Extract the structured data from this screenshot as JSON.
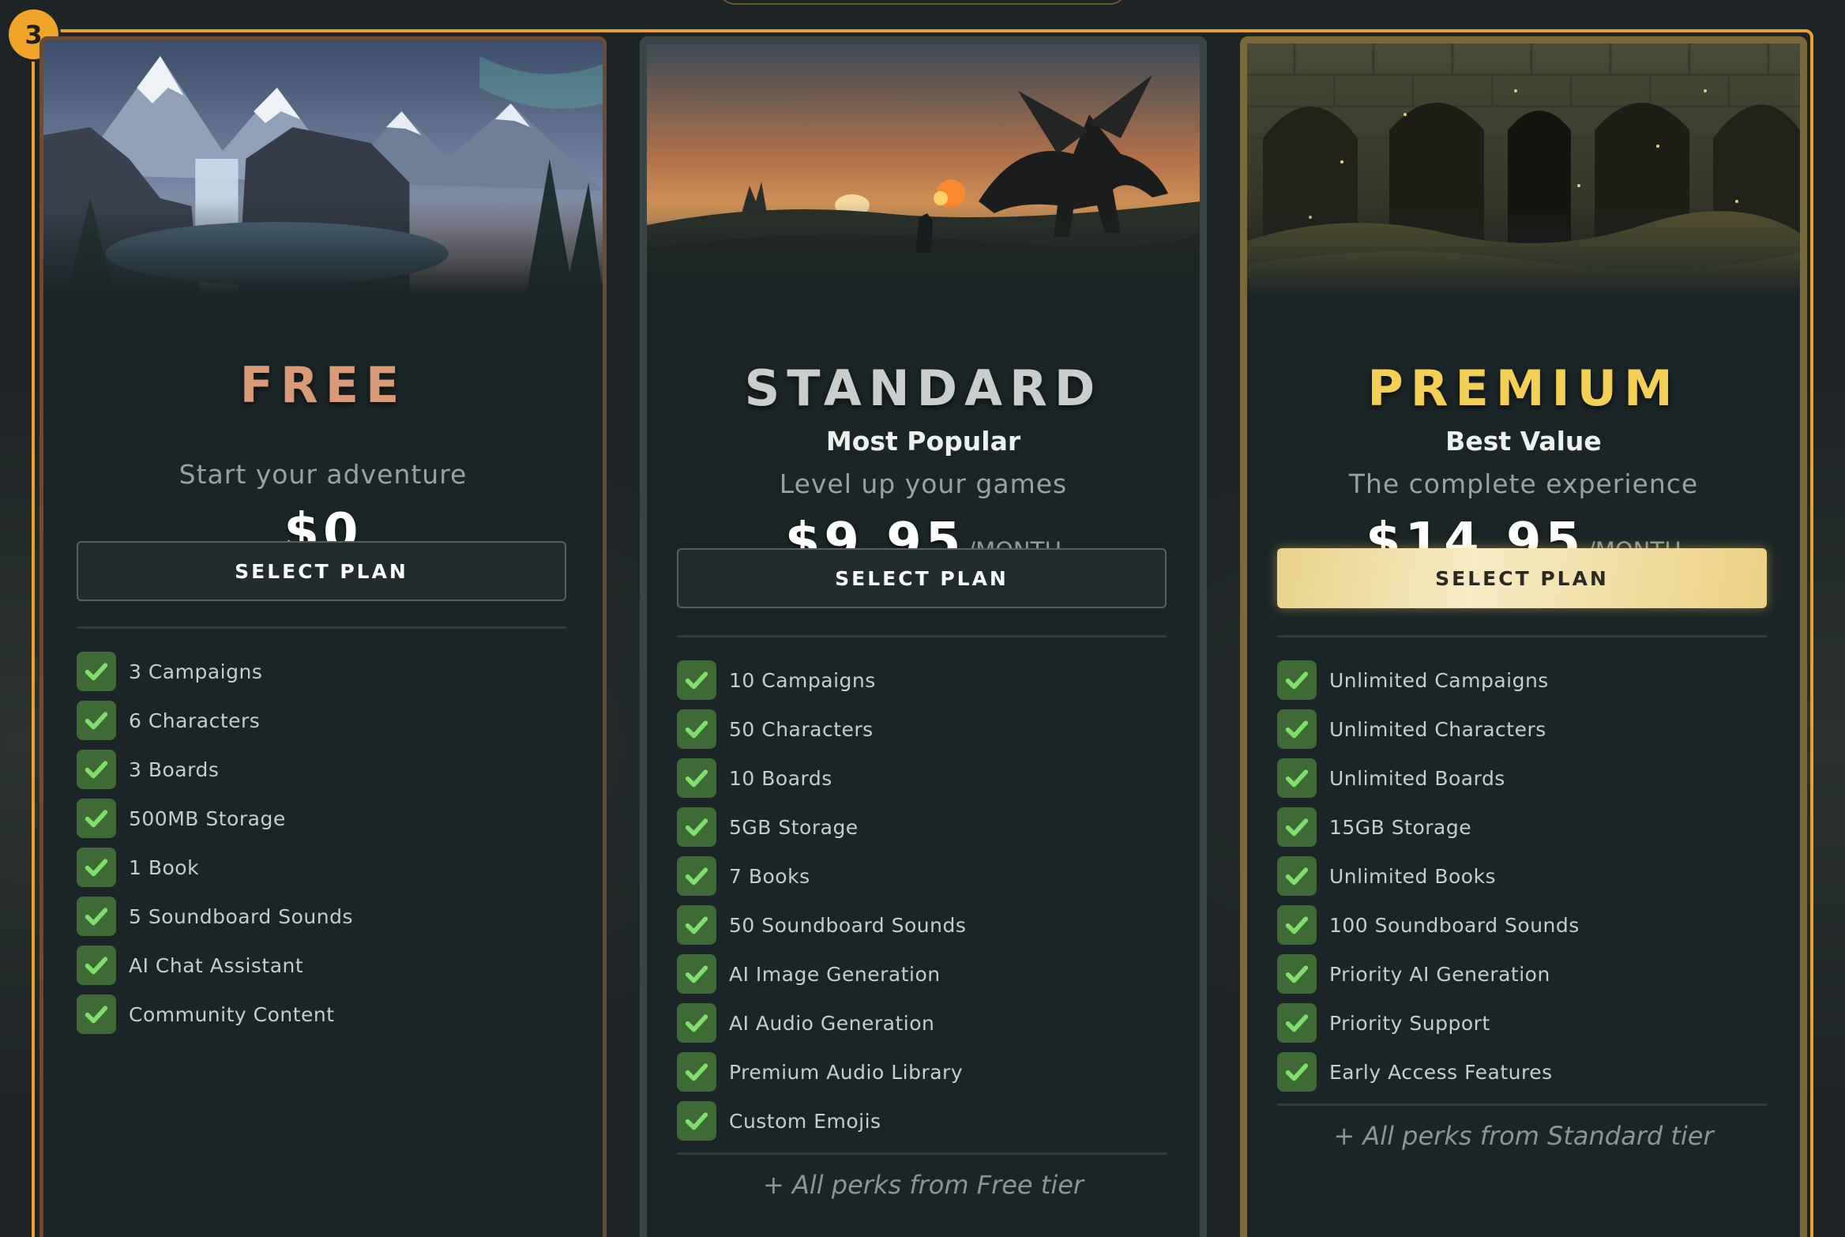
{
  "step_badge": "3",
  "plans": [
    {
      "id": "free",
      "name": "FREE",
      "badge": "",
      "tagline": "Start your adventure",
      "price": "$0",
      "period": "",
      "button_label": "SELECT PLAN",
      "features": [
        "3 Campaigns",
        "6 Characters",
        "3 Boards",
        "500MB Storage",
        "1 Book",
        "5 Soundboard Sounds",
        "AI Chat Assistant",
        "Community Content"
      ],
      "perks_note": "",
      "accent_color": "#d99a78",
      "image": "snowy-mountain-waterfall-scene"
    },
    {
      "id": "standard",
      "name": "STANDARD",
      "badge": "Most Popular",
      "tagline": "Level up your games",
      "price": "$9.95",
      "period": "/MONTH",
      "button_label": "SELECT PLAN",
      "features": [
        "10 Campaigns",
        "50 Characters",
        "10 Boards",
        "5GB Storage",
        "7 Books",
        "50 Soundboard Sounds",
        "AI Image Generation",
        "AI Audio Generation",
        "Premium Audio Library",
        "Custom Emojis"
      ],
      "perks_note": "+ All perks from Free tier",
      "accent_color": "#c9cdce",
      "image": "dragon-knight-sunset-scene"
    },
    {
      "id": "premium",
      "name": "PREMIUM",
      "badge": "Best Value",
      "tagline": "The complete experience",
      "price": "$14.95",
      "period": "/MONTH",
      "button_label": "SELECT PLAN",
      "features": [
        "Unlimited Campaigns",
        "Unlimited Characters",
        "Unlimited Boards",
        "15GB Storage",
        "Unlimited Books",
        "100 Soundboard Sounds",
        "Priority AI Generation",
        "Priority Support",
        "Early Access Features"
      ],
      "perks_note": "+ All perks from Standard tier",
      "accent_color": "#f4cf55",
      "image": "stone-dungeon-arches-scene"
    }
  ],
  "colors": {
    "selection_frame": "#e8a12b",
    "check_bg": "#3e6a35",
    "check_mark": "#7ee06a",
    "premium_button": "#ecd184"
  }
}
